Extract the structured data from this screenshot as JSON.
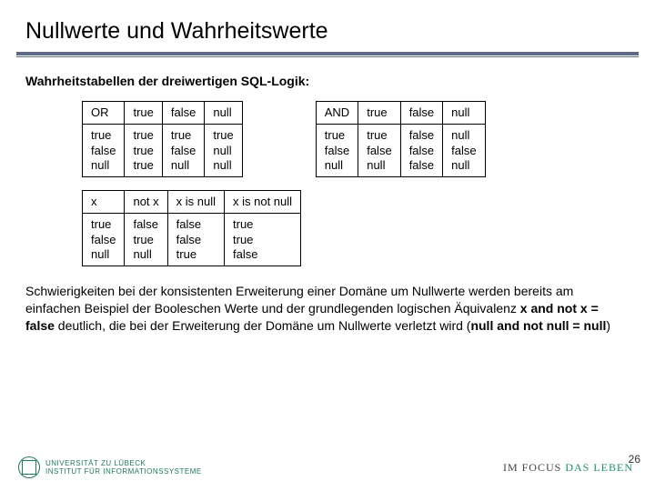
{
  "title": "Nullwerte und Wahrheitswerte",
  "subtitle": "Wahrheitstabellen der dreiwertigen SQL-Logik:",
  "or_table": {
    "op": "OR",
    "cols": [
      "true",
      "false",
      "null"
    ],
    "rows_header": "true\nfalse\nnull",
    "c1": "true\ntrue\ntrue",
    "c2": "true\nfalse\nnull",
    "c3": "true\nnull\nnull"
  },
  "and_table": {
    "op": "AND",
    "cols": [
      "true",
      "false",
      "null"
    ],
    "rows_header": "true\nfalse\nnull",
    "c1": "true\nfalse\nnull",
    "c2": "false\nfalse\nfalse",
    "c3": "null\nfalse\nnull"
  },
  "unary_table": {
    "h0": "x",
    "h1": "not x",
    "h2": "x is null",
    "h3": "x is not null",
    "rows_header": "true\nfalse\nnull",
    "c1": "false\ntrue\nnull",
    "c2": "false\nfalse\ntrue",
    "c3": "true\ntrue\nfalse"
  },
  "body": {
    "p1a": "Schwierigkeiten bei der konsistenten Erweiterung einer Domäne um Nullwerte werden bereits am einfachen Beispiel der Booleschen Werte und der grundlegenden logischen Äquivalenz ",
    "p1b": "x and not x = false",
    "p1c": " deutlich, die bei der Erweiterung der Domäne um Nullwerte verletzt wird (",
    "p1d": "null and not null = null",
    "p1e": ")"
  },
  "footer": {
    "uni_line1": "UNIVERSITÄT ZU LÜBECK",
    "uni_line2": "INSTITUT FÜR INFORMATIONSSYSTEME",
    "slogan_a": "IM FOCUS ",
    "slogan_b": "DAS LEBEN",
    "page": "26"
  },
  "chart_data": [
    {
      "type": "table",
      "title": "OR truth table (three-valued SQL logic)",
      "categories": [
        "true",
        "false",
        "null"
      ],
      "series": [
        {
          "name": "true",
          "values": [
            "true",
            "true",
            "true"
          ]
        },
        {
          "name": "false",
          "values": [
            "true",
            "false",
            "null"
          ]
        },
        {
          "name": "null",
          "values": [
            "true",
            "null",
            "null"
          ]
        }
      ]
    },
    {
      "type": "table",
      "title": "AND truth table (three-valued SQL logic)",
      "categories": [
        "true",
        "false",
        "null"
      ],
      "series": [
        {
          "name": "true",
          "values": [
            "true",
            "false",
            "null"
          ]
        },
        {
          "name": "false",
          "values": [
            "false",
            "false",
            "false"
          ]
        },
        {
          "name": "null",
          "values": [
            "null",
            "false",
            "null"
          ]
        }
      ]
    },
    {
      "type": "table",
      "title": "Unary operators on x",
      "categories": [
        "not x",
        "x is null",
        "x is not null"
      ],
      "series": [
        {
          "name": "true",
          "values": [
            "false",
            "false",
            "true"
          ]
        },
        {
          "name": "false",
          "values": [
            "true",
            "false",
            "true"
          ]
        },
        {
          "name": "null",
          "values": [
            "null",
            "true",
            "false"
          ]
        }
      ]
    }
  ]
}
